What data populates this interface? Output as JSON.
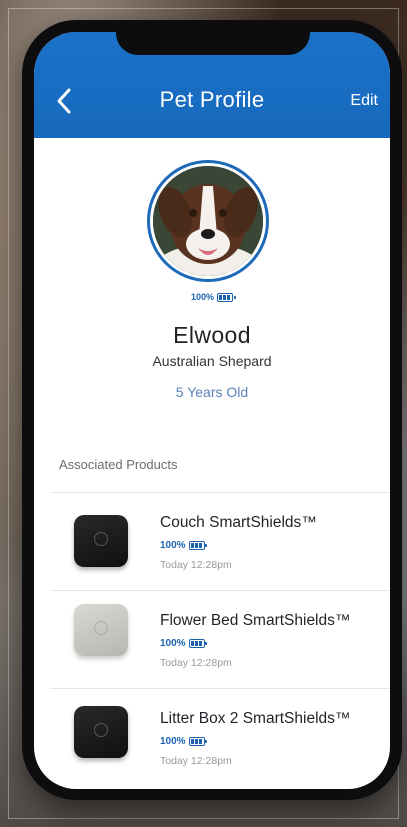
{
  "header": {
    "title": "Pet Profile",
    "edit_label": "Edit",
    "back_icon": "chevron-left-icon"
  },
  "pet": {
    "battery_text": "100%",
    "battery_level": 1.0,
    "name": "Elwood",
    "breed": "Australian Shepard",
    "age": "5 Years Old"
  },
  "products_section": {
    "label": "Associated Products",
    "items": [
      {
        "name": "Couch SmartShields™",
        "battery": "100%",
        "battery_level": 1.0,
        "last_seen": "Today 12:28pm",
        "device_color": "dark"
      },
      {
        "name": "Flower Bed  SmartShields™",
        "battery": "100%",
        "battery_level": 1.0,
        "last_seen": "Today 12:28pm",
        "device_color": "light"
      },
      {
        "name": "Litter Box 2 SmartShields™",
        "battery": "100%",
        "battery_level": 1.0,
        "last_seen": "Today 12:28pm",
        "device_color": "dark"
      }
    ]
  },
  "colors": {
    "header_blue": "#1a72c8",
    "accent_blue": "#1d63b0",
    "age_blue": "#5a82b4"
  }
}
